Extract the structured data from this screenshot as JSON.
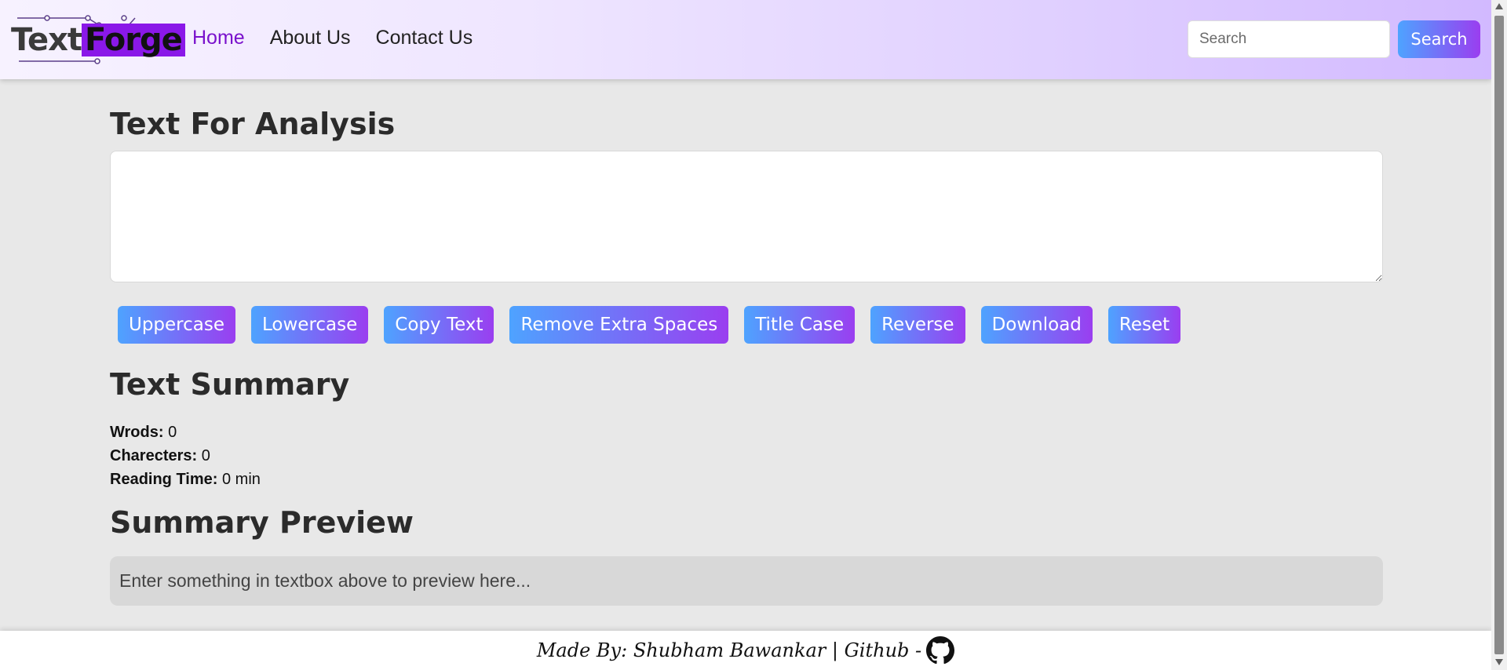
{
  "navbar": {
    "logo": {
      "part1": "Text",
      "part2": "Forge"
    },
    "links": [
      {
        "label": "Home",
        "active": true
      },
      {
        "label": "About Us",
        "active": false
      },
      {
        "label": "Contact Us",
        "active": false
      }
    ],
    "search": {
      "placeholder": "Search",
      "value": "",
      "button_label": "Search"
    }
  },
  "main": {
    "analysis_heading": "Text For Analysis",
    "textarea_value": "",
    "buttons": [
      "Uppercase",
      "Lowercase",
      "Copy Text",
      "Remove Extra Spaces",
      "Title Case",
      "Reverse",
      "Download",
      "Reset"
    ],
    "summary_heading": "Text Summary",
    "stats": {
      "words_label": "Wrods:",
      "words_value": " 0",
      "chars_label": "Charecters:",
      "chars_value": " 0",
      "reading_label": "Reading Time:",
      "reading_value": " 0 min"
    },
    "preview_heading": "Summary Preview",
    "preview_text": "Enter something in textbox above to preview here..."
  },
  "footer": {
    "text": "Made By: Shubham Bawankar | Github -",
    "icon": "github-icon"
  },
  "colors": {
    "accent": "#7a12cc",
    "button_gradient_start": "#4ea3ff",
    "button_gradient_end": "#9a3ef0",
    "logo_highlight": "#8a18e8"
  }
}
